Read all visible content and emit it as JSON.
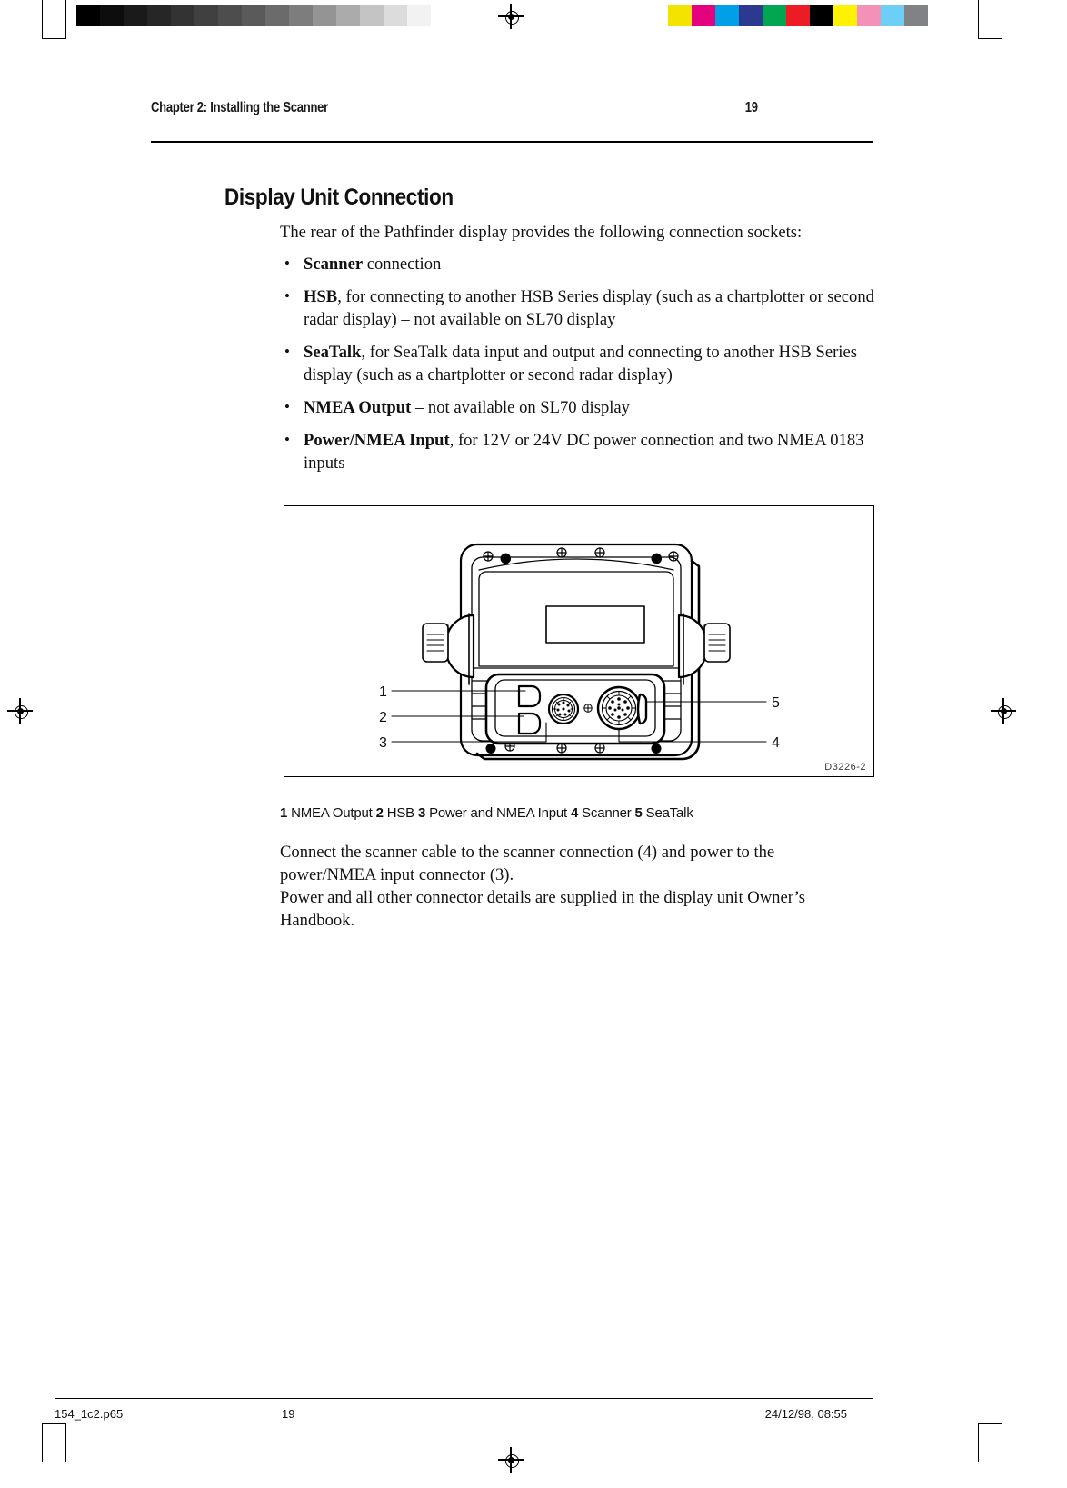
{
  "header": {
    "chapter": "Chapter  2: Installing the Scanner",
    "page_number": "19"
  },
  "heading": "Display Unit Connection",
  "intro": "The rear of the Pathfinder display provides the following connection sockets:",
  "bullets": [
    {
      "term": "Scanner",
      "rest": " connection"
    },
    {
      "term": "HSB",
      "rest": ", for connecting to another HSB Series display (such as a chartplotter or second radar display) – not available on SL70 display"
    },
    {
      "term": "SeaTalk",
      "rest": ", for SeaTalk data input and output and connecting to another HSB Series display (such as a chartplotter or second radar display)"
    },
    {
      "term": "NMEA Output",
      "rest": " – not available on SL70 display"
    },
    {
      "term": "Power/NMEA Input",
      "rest": ", for 12V or 24V DC power connection and two NMEA 0183 inputs"
    }
  ],
  "figure": {
    "drawing_code": "D3226-2",
    "alt": "Rear view of the Pathfinder display unit showing connection sockets",
    "callouts": [
      {
        "number": "1",
        "side": "left"
      },
      {
        "number": "2",
        "side": "left"
      },
      {
        "number": "3",
        "side": "left"
      },
      {
        "number": "4",
        "side": "right"
      },
      {
        "number": "5",
        "side": "right"
      }
    ],
    "caption_items": [
      {
        "number": "1",
        "label": "NMEA Output"
      },
      {
        "number": "2",
        "label": "HSB"
      },
      {
        "number": "3",
        "label": "Power and NMEA Input"
      },
      {
        "number": "4",
        "label": "Scanner"
      },
      {
        "number": "5",
        "label": "SeaTalk"
      }
    ]
  },
  "closing": {
    "line1": "Connect the scanner cable to the scanner connection (4) and power to the",
    "line2": "power/NMEA input connector (3).",
    "line3": "Power and all other connector details are supplied in the display unit Owner’s",
    "line4": "Handbook."
  },
  "footer": {
    "filename": "154_1c2.p65",
    "page": "19",
    "timestamp": "24/12/98, 08:55"
  },
  "calibration": {
    "greyscale": [
      "#000000",
      "#0d0d0d",
      "#1a1a1a",
      "#262626",
      "#333333",
      "#404040",
      "#4d4d4d",
      "#5a5a5a",
      "#6b6b6b",
      "#7d7d7d",
      "#949494",
      "#ababab",
      "#c4c4c4",
      "#dcdcdc",
      "#f2f2f2"
    ],
    "colors": [
      "#f2e400",
      "#e5007e",
      "#00a0e9",
      "#2b3990",
      "#00a651",
      "#ed1c24",
      "#000000",
      "#fff200",
      "#f391b8",
      "#6dcff6",
      "#808285"
    ]
  }
}
